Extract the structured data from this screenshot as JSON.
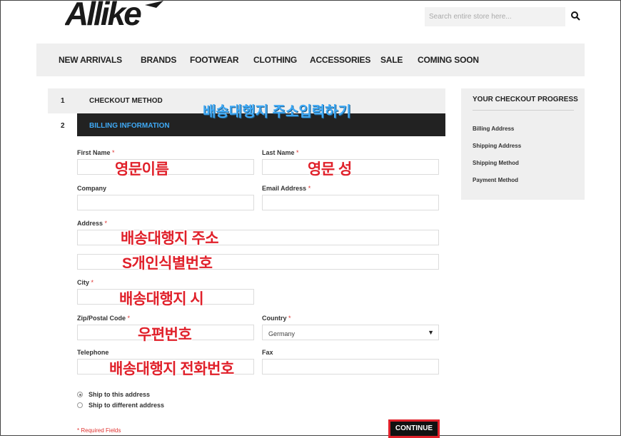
{
  "brand": {
    "logo_text": "Allike"
  },
  "search": {
    "placeholder": "Search entire store here..."
  },
  "nav": [
    "NEW ARRIVALS",
    "BRANDS",
    "FOOTWEAR",
    "CLOTHING",
    "ACCESSORIES",
    "SALE",
    "COMING SOON"
  ],
  "steps": [
    {
      "number": "1",
      "title": "CHECKOUT METHOD"
    },
    {
      "number": "2",
      "title": "BILLING INFORMATION"
    }
  ],
  "form": {
    "first_name": "First Name",
    "last_name": "Last Name",
    "company": "Company",
    "email": "Email Address",
    "address": "Address",
    "city": "City",
    "zip": "Zip/Postal Code",
    "country": "Country",
    "country_value": "Germany",
    "telephone": "Telephone",
    "fax": "Fax",
    "required_mark": "*",
    "ship_options": [
      "Ship to this address",
      "Ship to different address"
    ],
    "required_note": "* Required Fields",
    "continue_label": "CONTINUE"
  },
  "annotations": {
    "title": "배송대행지 주소입력하기",
    "first_name": "영문이름",
    "last_name": "영문 성",
    "address1": "배송대행지 주소",
    "address2": "S개인식별번호",
    "city": "배송대행지 시",
    "zip": "우편번호",
    "telephone": "배송대행지 전화번호"
  },
  "progress": {
    "title": "YOUR CHECKOUT PROGRESS",
    "items": [
      "Billing Address",
      "Shipping Address",
      "Shipping Method",
      "Payment Method"
    ]
  },
  "colors": {
    "accent_blue": "#3fa9f5",
    "annotation_red": "#e0202a",
    "required_red": "#e0322f",
    "dark_bar": "#222222"
  }
}
